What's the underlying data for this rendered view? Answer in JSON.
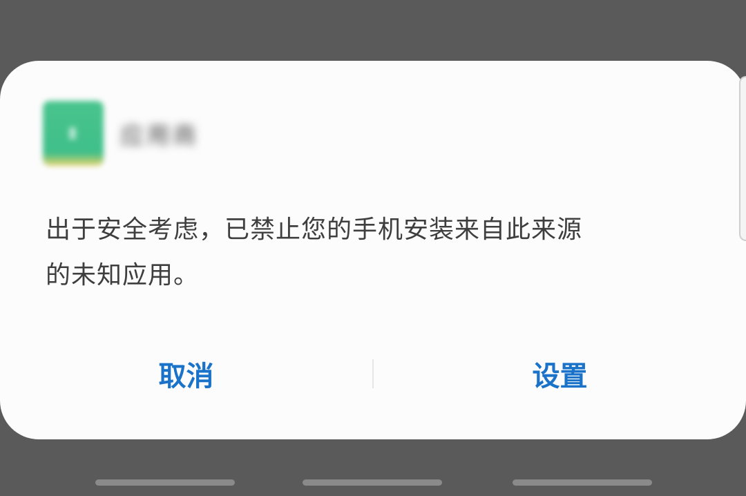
{
  "dialog": {
    "app_name": "应用商",
    "message_line1": "出于安全考虑，已禁止您的手机安装来自此来源",
    "message_line2": "的未知应用。",
    "cancel_label": "取消",
    "settings_label": "设置"
  },
  "colors": {
    "backdrop": "#5a5a5a",
    "dialog_bg": "#fcfcfc",
    "action_text": "#1a73c9",
    "message_text": "#3e3e3e"
  },
  "icons": {
    "app": "app-icon"
  }
}
